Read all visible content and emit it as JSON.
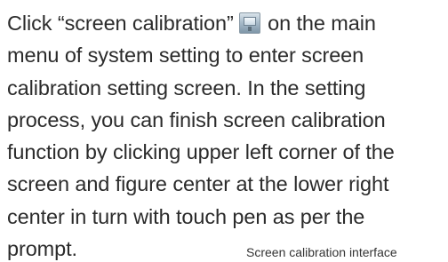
{
  "paragraph": {
    "line1_before_icon": "Click “screen calibration”",
    "line1_after_icon": "on the main",
    "line2": "menu of system setting to enter screen",
    "line3": "calibration setting screen. In the setting",
    "line4": "process, you can finish screen calibration",
    "line5": "function by clicking upper left corner of the",
    "line6": "screen and figure center at the lower right",
    "line7": "center in turn with touch pen as per the",
    "line8": "prompt."
  },
  "icons": {
    "inline_icon": "screen-calibration-icon"
  },
  "caption": {
    "text": "Screen calibration interface"
  }
}
